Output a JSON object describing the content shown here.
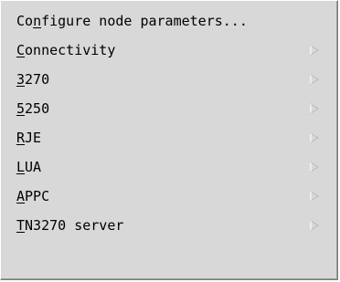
{
  "menu": {
    "items": [
      {
        "label": "Configure node parameters...",
        "mnemonic_index": 2,
        "has_submenu": false
      },
      {
        "label": "Connectivity",
        "mnemonic_index": 0,
        "has_submenu": true
      },
      {
        "label": "3270",
        "mnemonic_index": 0,
        "has_submenu": true
      },
      {
        "label": "5250",
        "mnemonic_index": 0,
        "has_submenu": true
      },
      {
        "label": "RJE",
        "mnemonic_index": 0,
        "has_submenu": true
      },
      {
        "label": "LUA",
        "mnemonic_index": 0,
        "has_submenu": true
      },
      {
        "label": "APPC",
        "mnemonic_index": 0,
        "has_submenu": true
      },
      {
        "label": "TN3270 server",
        "mnemonic_index": 0,
        "has_submenu": true
      }
    ],
    "submenu_icon": "submenu-arrow-icon",
    "colors": {
      "background": "#d8d8d8",
      "text": "#000000",
      "arrow": "#b8b8b8"
    }
  }
}
